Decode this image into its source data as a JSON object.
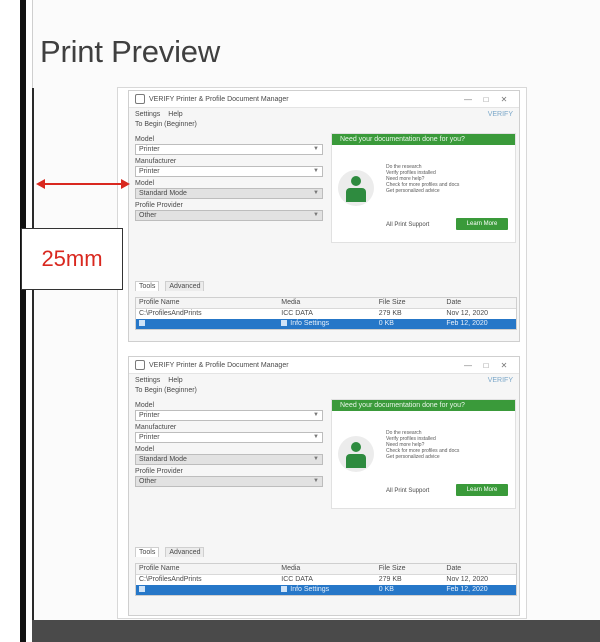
{
  "page": {
    "title": "Print Preview"
  },
  "annotation": {
    "label": "25mm",
    "color": "#d9281f"
  },
  "windows": [
    {
      "title": "VERIFY Printer & Profile Document Manager",
      "menu": [
        "Settings",
        "Help"
      ],
      "menu_logo": "VERIFY",
      "subline": "To Begin (Beginner)",
      "fields": [
        {
          "label": "Model",
          "value": "Printer"
        },
        {
          "label": "Manufacturer",
          "value": "Printer"
        },
        {
          "label": "Model",
          "value": "Standard Mode"
        },
        {
          "label": "Profile Provider",
          "value": "Other"
        }
      ],
      "promo": {
        "banner": "Need your documentation done for you?",
        "lines": [
          "Do the research",
          "Verify profiles installed",
          "Need more help?",
          "Check for more profiles and docs",
          "Get personalized advice"
        ],
        "subtext": "All Print Support",
        "button": "Learn More"
      },
      "tabs": [
        "Tools",
        "Advanced"
      ],
      "table": {
        "headers": [
          "Profile Name",
          "Media",
          "File Size",
          "Date"
        ],
        "rows": [
          [
            "C:\\ProfilesAndPrints",
            "ICC DATA",
            "279 KB",
            "Nov 12, 2020"
          ],
          [
            "",
            "Info Settings",
            "0 KB",
            "Feb 12, 2020"
          ]
        ]
      }
    },
    {
      "title": "VERIFY Printer & Profile Document Manager",
      "menu": [
        "Settings",
        "Help"
      ],
      "menu_logo": "VERIFY",
      "subline": "To Begin (Beginner)",
      "fields": [
        {
          "label": "Model",
          "value": "Printer"
        },
        {
          "label": "Manufacturer",
          "value": "Printer"
        },
        {
          "label": "Model",
          "value": "Standard Mode"
        },
        {
          "label": "Profile Provider",
          "value": "Other"
        }
      ],
      "promo": {
        "banner": "Need your documentation done for you?",
        "lines": [
          "Do the research",
          "Verify profiles installed",
          "Need more help?",
          "Check for more profiles and docs",
          "Get personalized advice"
        ],
        "subtext": "All Print Support",
        "button": "Learn More"
      },
      "tabs": [
        "Tools",
        "Advanced"
      ],
      "table": {
        "headers": [
          "Profile Name",
          "Media",
          "File Size",
          "Date"
        ],
        "rows": [
          [
            "C:\\ProfilesAndPrints",
            "ICC DATA",
            "279 KB",
            "Nov 12, 2020"
          ],
          [
            "",
            "Info Settings",
            "0 KB",
            "Feb 12, 2020"
          ]
        ]
      }
    }
  ]
}
